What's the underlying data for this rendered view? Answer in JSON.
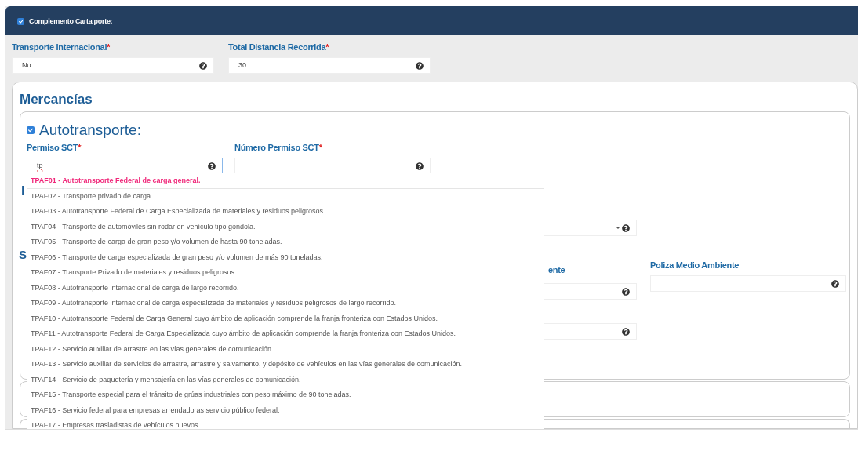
{
  "header": {
    "label": "Complemento Carta porte:",
    "checked": true
  },
  "fields": [
    {
      "label": "Transporte Internacional",
      "required_mark": "*",
      "value": "No"
    },
    {
      "label": "Total Distancia Recorrida",
      "required_mark": "*",
      "value": "30"
    }
  ],
  "mercancias": {
    "title": "Mercancías",
    "autotransporte": {
      "label": "Autotransporte:",
      "checked": true,
      "fields": [
        {
          "label": "Permiso SCT",
          "required_mark": "*",
          "value": "tp",
          "focused": true
        },
        {
          "label": "Número Permiso SCT",
          "required_mark": "*",
          "focused": false
        }
      ]
    },
    "hidden_headings": [
      "I",
      "S"
    ],
    "partial_label": "ente",
    "poliza": {
      "label": "Poliza Medio Ambiente"
    }
  },
  "dropdown": [
    {
      "text": "TPAF01 - Autotransporte Federal de carga general.",
      "selected": true
    },
    {
      "text": "TPAF02 - Transporte privado de carga.",
      "selected": false
    },
    {
      "text": "TPAF03 - Autotransporte Federal de Carga Especializada de materiales y residuos peligrosos.",
      "selected": false
    },
    {
      "text": "TPAF04 - Transporte de automóviles sin rodar en vehículo tipo góndola.",
      "selected": false
    },
    {
      "text": "TPAF05 - Transporte de carga de gran peso y/o volumen de hasta 90 toneladas.",
      "selected": false
    },
    {
      "text": "TPAF06 - Transporte de carga especializada de gran peso y/o volumen de más 90 toneladas.",
      "selected": false
    },
    {
      "text": "TPAF07 - Transporte Privado de materiales y residuos peligrosos.",
      "selected": false
    },
    {
      "text": "TPAF08 - Autotransporte internacional de carga de largo recorrido.",
      "selected": false
    },
    {
      "text": "TPAF09 - Autotransporte internacional de carga especializada de materiales y residuos peligrosos de largo recorrido.",
      "selected": false
    },
    {
      "text": "TPAF10 - Autotransporte Federal de Carga General cuyo ámbito de aplicación comprende la franja fronteriza con Estados Unidos.",
      "selected": false
    },
    {
      "text": "TPAF11 - Autotransporte Federal de Carga Especializada cuyo ámbito de aplicación comprende la franja fronteriza con Estados Unidos.",
      "selected": false
    },
    {
      "text": "TPAF12 - Servicio auxiliar de arrastre en las vías generales de comunicación.",
      "selected": false
    },
    {
      "text": "TPAF13 - Servicio auxiliar de servicios de arrastre, arrastre y salvamento, y depósito de vehículos en las vías generales de comunicación.",
      "selected": false
    },
    {
      "text": "TPAF14 - Servicio de paquetería y mensajería en las vías generales de comunicación.",
      "selected": false
    },
    {
      "text": "TPAF15 - Transporte especial para el tránsito de grúas industriales con peso máximo de 90 toneladas.",
      "selected": false
    },
    {
      "text": "TPAF16 - Servicio federal para empresas arrendadoras servicio público federal.",
      "selected": false
    },
    {
      "text": "TPAF17 - Empresas trasladistas de vehículos nuevos.",
      "selected": false
    }
  ]
}
